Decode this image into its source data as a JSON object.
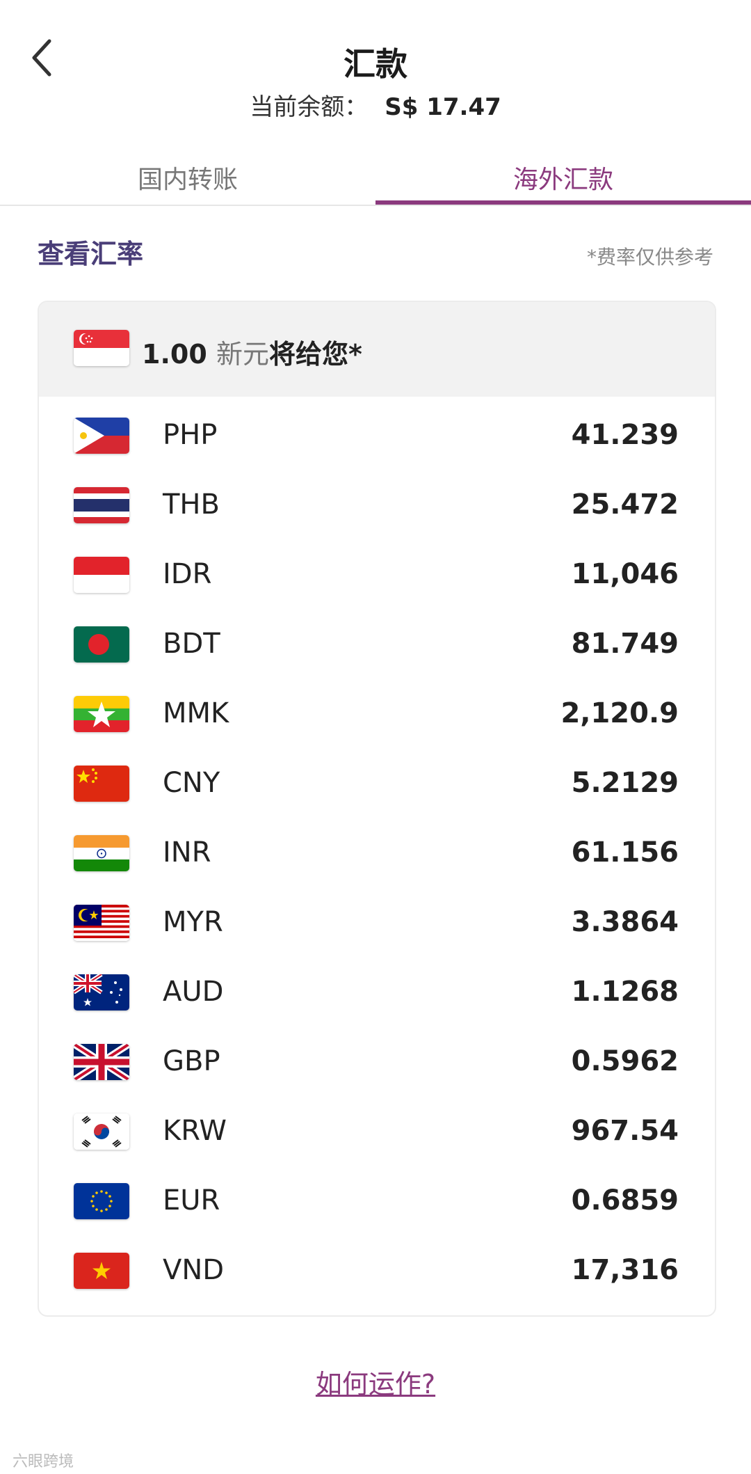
{
  "header": {
    "title": "汇款",
    "balance_label": "当前余额：",
    "balance_value": "S$ 17.47"
  },
  "tabs": [
    {
      "label": "国内转账",
      "active": false
    },
    {
      "label": "海外汇款",
      "active": true
    }
  ],
  "section": {
    "title": "查看汇率",
    "note": "*费率仅供参考"
  },
  "base": {
    "amount": "1.00",
    "currency": "新元",
    "suffix": "将给您*"
  },
  "rates": [
    {
      "code": "PHP",
      "rate": "41.239"
    },
    {
      "code": "THB",
      "rate": "25.472"
    },
    {
      "code": "IDR",
      "rate": "11,046"
    },
    {
      "code": "BDT",
      "rate": "81.749"
    },
    {
      "code": "MMK",
      "rate": "2,120.9"
    },
    {
      "code": "CNY",
      "rate": "5.2129"
    },
    {
      "code": "INR",
      "rate": "61.156"
    },
    {
      "code": "MYR",
      "rate": "3.3864"
    },
    {
      "code": "AUD",
      "rate": "1.1268"
    },
    {
      "code": "GBP",
      "rate": "0.5962"
    },
    {
      "code": "KRW",
      "rate": "967.54"
    },
    {
      "code": "EUR",
      "rate": "0.6859"
    },
    {
      "code": "VND",
      "rate": "17,316"
    }
  ],
  "footer": {
    "help_link": "如何运作?"
  },
  "watermark": "六眼跨境",
  "colors": {
    "accent": "#8b3a7e",
    "section_title": "#4a3e78"
  }
}
